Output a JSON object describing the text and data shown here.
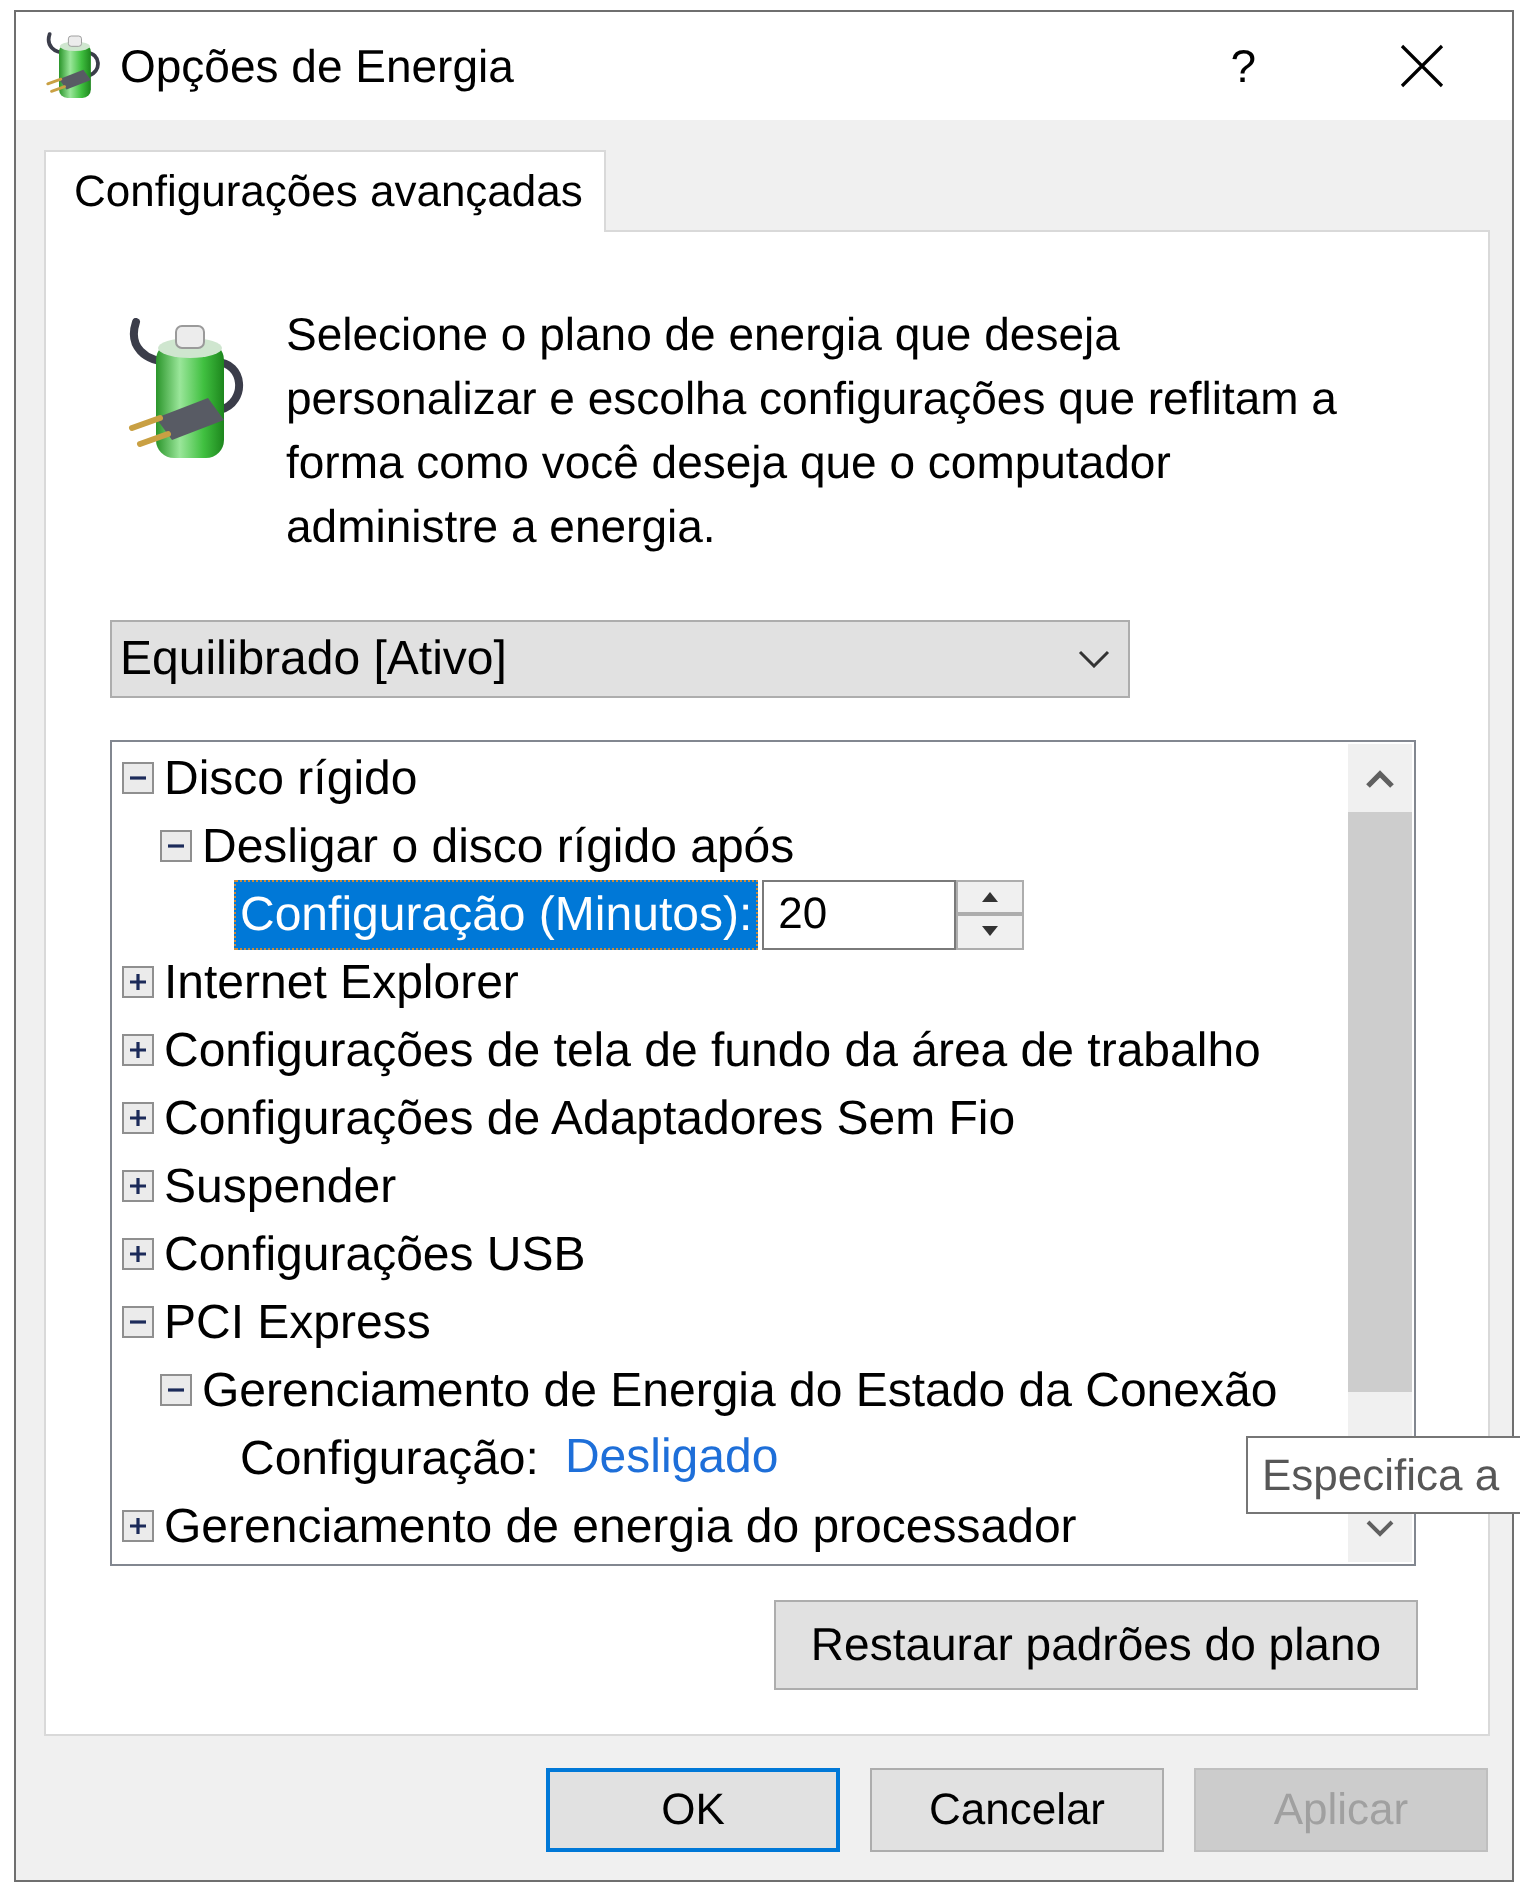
{
  "window": {
    "title": "Opções de Energia",
    "help": "?"
  },
  "tabs": [
    {
      "label": "Configurações avançadas",
      "selected": true
    }
  ],
  "description": "Selecione o plano de energia que deseja personalizar e escolha configurações que reflitam a forma como você deseja que o computador administre a energia.",
  "plan_dropdown": {
    "value": "Equilibrado [Ativo]"
  },
  "settings_tree": {
    "items": [
      {
        "kind": "group",
        "label": "Disco rígido",
        "expanded": true,
        "selected": false,
        "children": [
          {
            "kind": "group",
            "label": "Desligar o disco rígido após",
            "expanded": true,
            "selected": false,
            "children": [
              {
                "kind": "spin",
                "label": "Configuração (Minutos):",
                "value": "20",
                "selected": true
              }
            ]
          }
        ]
      },
      {
        "kind": "group",
        "label": "Internet Explorer",
        "expanded": false,
        "selected": false
      },
      {
        "kind": "group",
        "label": "Configurações de tela de fundo da área de trabalho",
        "expanded": false,
        "selected": false
      },
      {
        "kind": "group",
        "label": "Configurações de Adaptadores Sem Fio",
        "expanded": false,
        "selected": false
      },
      {
        "kind": "group",
        "label": "Suspender",
        "expanded": false,
        "selected": false
      },
      {
        "kind": "group",
        "label": "Configurações USB",
        "expanded": false,
        "selected": false
      },
      {
        "kind": "group",
        "label": "PCI Express",
        "expanded": true,
        "selected": false,
        "children": [
          {
            "kind": "group",
            "label": "Gerenciamento de Energia do Estado da Conexão",
            "expanded": true,
            "selected": false,
            "children": [
              {
                "kind": "link",
                "label": "Configuração:",
                "value": "Desligado",
                "selected": false
              }
            ]
          }
        ]
      },
      {
        "kind": "group",
        "label": "Gerenciamento de energia do processador",
        "expanded": false,
        "selected": false
      }
    ]
  },
  "restore_button": "Restaurar padrões do plano",
  "buttons": [
    {
      "label": "OK",
      "default": true,
      "disabled": false
    },
    {
      "label": "Cancelar",
      "default": false,
      "disabled": false
    },
    {
      "label": "Aplicar",
      "default": false,
      "disabled": true
    }
  ],
  "tooltip": "Especifica a"
}
